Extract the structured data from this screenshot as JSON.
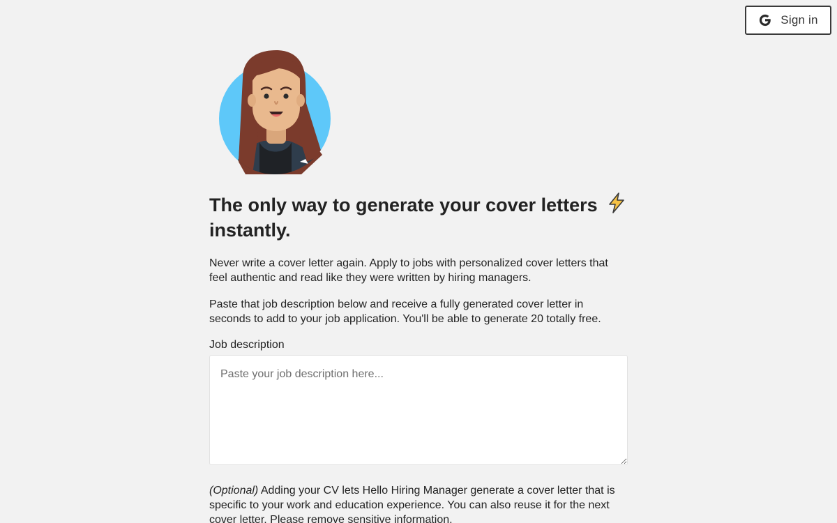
{
  "header": {
    "signin_label": "Sign in",
    "signin_icon": "google-g-icon"
  },
  "hero": {
    "avatar_icon": "woman-avatar-illustration",
    "headline": "The only way to generate your cover letters",
    "headline_line2": "instantly.",
    "headline_icon": "lightning-bolt-icon"
  },
  "intro": {
    "paragraph1": "Never write a cover letter again. Apply to jobs with personalized cover letters that feel authentic and read like they were written by hiring managers.",
    "paragraph2": "Paste that job description below and receive a fully generated cover letter in seconds to add to your job application. You'll be able to generate 20 totally free."
  },
  "form": {
    "job_description_label": "Job description",
    "job_description_placeholder": "Paste your job description here...",
    "job_description_value": "",
    "cv_optional_label": "(Optional)",
    "cv_text": " Adding your CV lets Hello Hiring Manager generate a cover letter that is specific to your work and education experience. You can also reuse it for the next cover letter. Please remove sensitive information."
  },
  "colors": {
    "background": "#f2f2f2",
    "avatar_circle": "#5ec8f9",
    "hair": "#7b3b2c",
    "skin": "#e9b98e",
    "bolt_fill": "#f6c244"
  }
}
